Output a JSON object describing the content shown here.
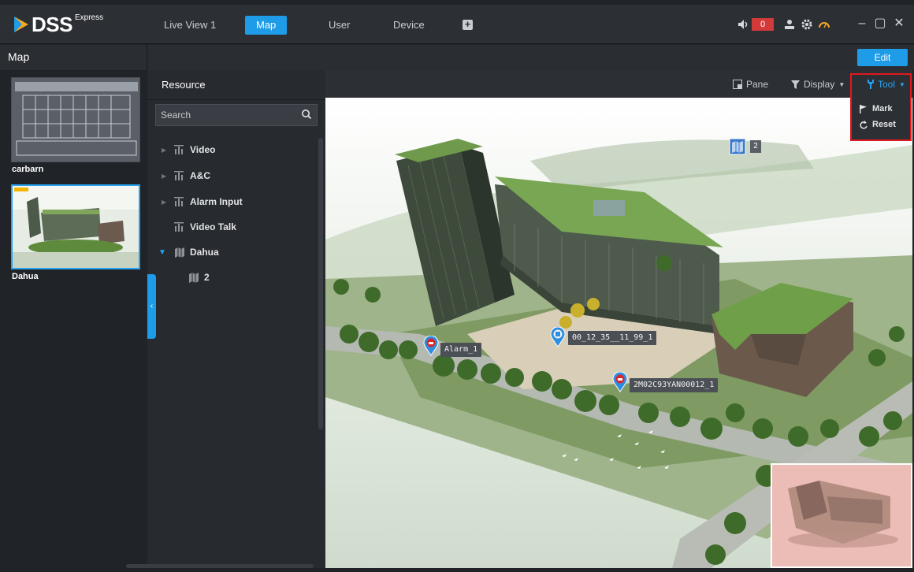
{
  "app": {
    "logo_text": "DSS",
    "logo_sup": "Express",
    "tabs": [
      {
        "label": "Live View 1",
        "active": false
      },
      {
        "label": "Map",
        "active": true
      },
      {
        "label": "User",
        "active": false
      },
      {
        "label": "Device",
        "active": false
      }
    ],
    "alarm_count": "0"
  },
  "subbar": {
    "title": "Map",
    "edit_label": "Edit"
  },
  "thumbnails": [
    {
      "label": "carbarn",
      "selected": false
    },
    {
      "label": "Dahua",
      "selected": true
    }
  ],
  "resource": {
    "title": "Resource",
    "search_placeholder": "Search",
    "tree": [
      {
        "label": "Video",
        "expanded": false
      },
      {
        "label": "A&C",
        "expanded": false
      },
      {
        "label": "Alarm Input",
        "expanded": false
      },
      {
        "label": "Video Talk",
        "expanded": false
      },
      {
        "label": "Dahua",
        "expanded": true
      },
      {
        "label": "2",
        "expanded": false
      }
    ]
  },
  "map_toolbar": {
    "pane_label": "Pane",
    "display_label": "Display",
    "tool_label": "Tool",
    "tool_menu": [
      "Mark",
      "Reset"
    ]
  },
  "map": {
    "submap_count": "2",
    "markers": [
      {
        "label": "Alarm_1",
        "kind": "alarm"
      },
      {
        "label": "00_12_35__11_99_1",
        "kind": "camera"
      },
      {
        "label": "2M02C93YAN00012_1",
        "kind": "alarm"
      }
    ]
  },
  "colors": {
    "accent": "#1e9ce8",
    "alarm_red": "#d23a3a",
    "highlight_border": "#e0191f"
  }
}
